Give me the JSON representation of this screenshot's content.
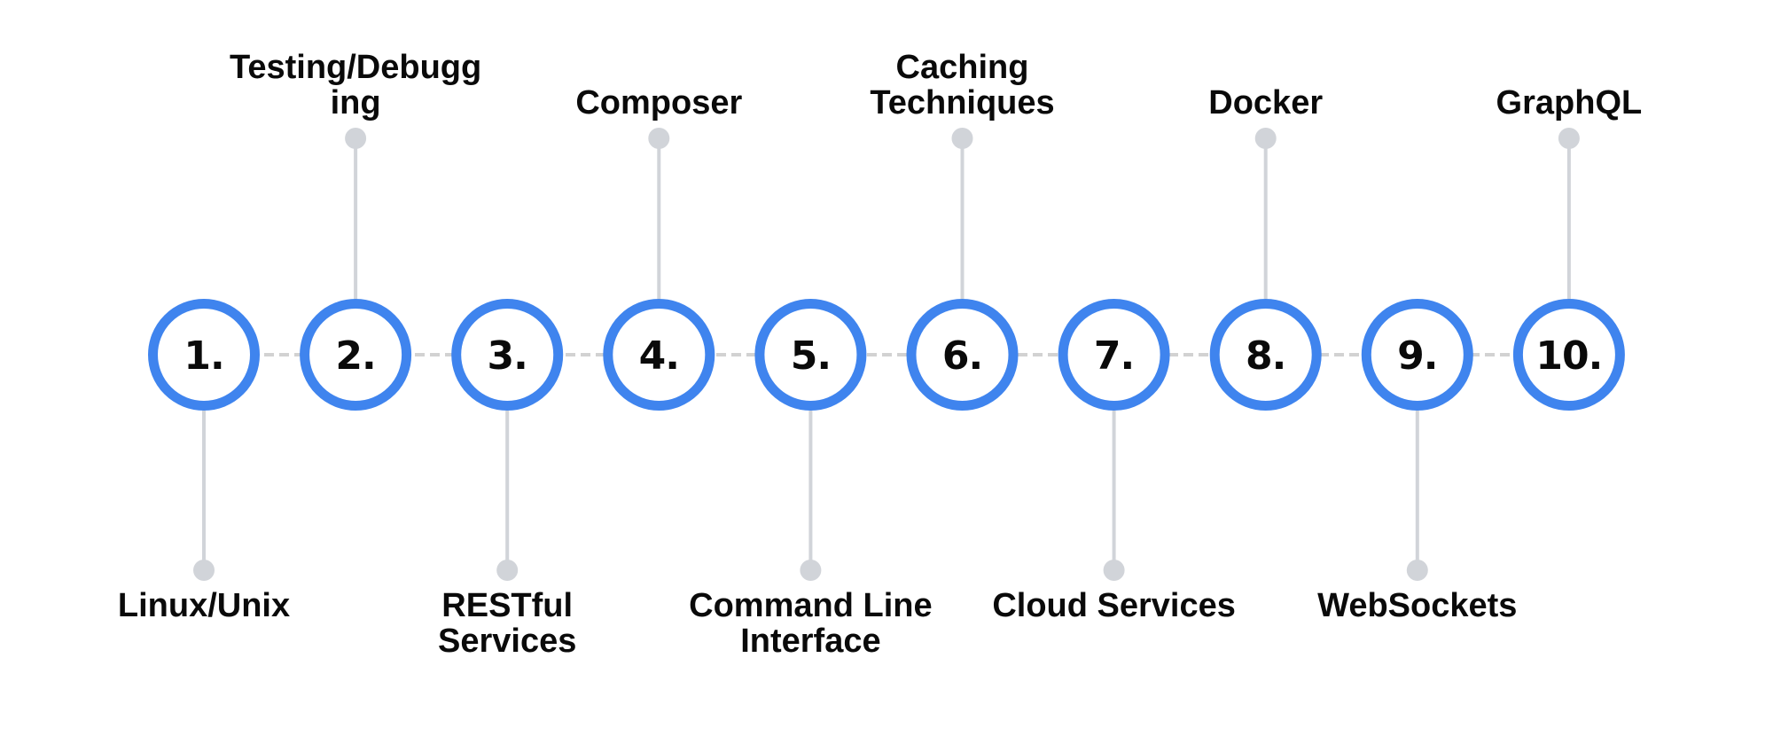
{
  "diagram": {
    "type": "timeline",
    "colors": {
      "ring": "#3F84EE",
      "connector": "#D1D4D9",
      "dashed_line": "#D2D2D2",
      "text": "#0A0A0A",
      "background": "#FFFFFF"
    },
    "items": [
      {
        "number": "1.",
        "label_lines": [
          "Linux/Unix"
        ],
        "label_position": "below"
      },
      {
        "number": "2.",
        "label_lines": [
          "Testing/Debugg",
          "ing"
        ],
        "label_position": "above"
      },
      {
        "number": "3.",
        "label_lines": [
          "RESTful",
          "Services"
        ],
        "label_position": "below"
      },
      {
        "number": "4.",
        "label_lines": [
          "Composer"
        ],
        "label_position": "above"
      },
      {
        "number": "5.",
        "label_lines": [
          "Command Line",
          "Interface"
        ],
        "label_position": "below"
      },
      {
        "number": "6.",
        "label_lines": [
          "Caching",
          "Techniques"
        ],
        "label_position": "above"
      },
      {
        "number": "7.",
        "label_lines": [
          "Cloud Services"
        ],
        "label_position": "below"
      },
      {
        "number": "8.",
        "label_lines": [
          "Docker"
        ],
        "label_position": "above"
      },
      {
        "number": "9.",
        "label_lines": [
          "WebSockets"
        ],
        "label_position": "below"
      },
      {
        "number": "10.",
        "label_lines": [
          "GraphQL"
        ],
        "label_position": "above"
      }
    ]
  }
}
